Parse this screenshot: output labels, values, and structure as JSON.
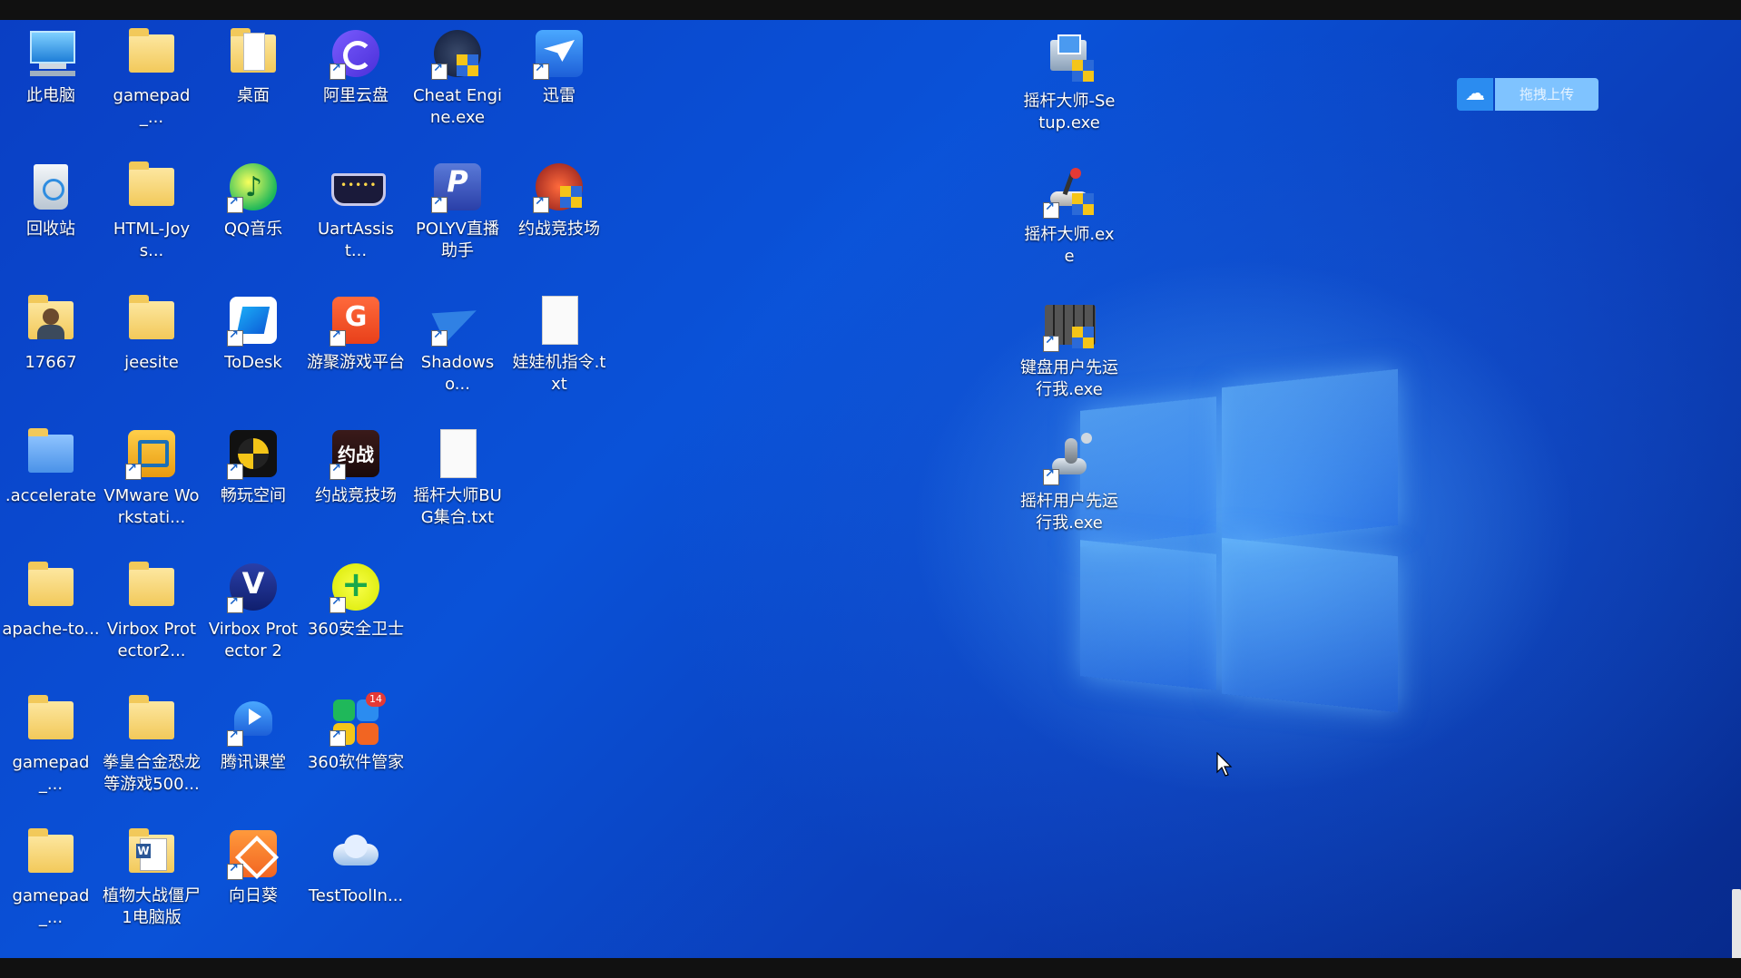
{
  "desktop": {
    "icons": [
      {
        "name": "此电脑",
        "type": "computer"
      },
      {
        "name": "回收站",
        "type": "recycle"
      },
      {
        "name": "17667",
        "type": "user-folder"
      },
      {
        "name": ".accelerate",
        "type": "folder-blue"
      },
      {
        "name": "apache-to...",
        "type": "folder"
      },
      {
        "name": "gamepad_...",
        "type": "folder"
      },
      {
        "name": "gamepad_...",
        "type": "folder"
      },
      {
        "name": "gamepad_...",
        "type": "folder"
      },
      {
        "name": "HTML-Joys...",
        "type": "folder"
      },
      {
        "name": "jeesite",
        "type": "folder"
      },
      {
        "name": "VMware Workstati...",
        "type": "vmware"
      },
      {
        "name": "Virbox Protector2...",
        "type": "folder"
      },
      {
        "name": "拳皇合金恐龙等游戏500...",
        "type": "folder"
      },
      {
        "name": "植物大战僵尸1电脑版",
        "type": "word-doc"
      },
      {
        "name": "桌面",
        "type": "folder-doc"
      },
      {
        "name": "QQ音乐",
        "type": "qqmusic"
      },
      {
        "name": "ToDesk",
        "type": "todesk"
      },
      {
        "name": "畅玩空间",
        "type": "changwan"
      },
      {
        "name": "Virbox Protector 2",
        "type": "virbox"
      },
      {
        "name": "腾讯课堂",
        "type": "tencent-class"
      },
      {
        "name": "向日葵",
        "type": "sunflower"
      },
      {
        "name": "阿里云盘",
        "type": "aliyun"
      },
      {
        "name": "UartAssist...",
        "type": "uart"
      },
      {
        "name": "游聚游戏平台",
        "type": "youju"
      },
      {
        "name": "约战竞技场",
        "type": "yuezhan"
      },
      {
        "name": "360安全卫士",
        "type": "360safe"
      },
      {
        "name": "360软件管家",
        "type": "360soft",
        "badge": "14"
      },
      {
        "name": "TestToolIn...",
        "type": "cloud"
      },
      {
        "name": "Cheat Engine.exe",
        "type": "cheat-engine"
      },
      {
        "name": "POLYV直播助手",
        "type": "polyv"
      },
      {
        "name": "Shadowso...",
        "type": "shadowsocks"
      },
      {
        "name": "摇杆大师BUG集合.txt",
        "type": "txt"
      },
      {
        "name": "迅雷",
        "type": "xunlei"
      },
      {
        "name": "约战竞技场",
        "type": "yuezhan2"
      },
      {
        "name": "娃娃机指令.txt",
        "type": "txt"
      },
      {
        "name": "摇杆大师-Setup.exe",
        "type": "setup"
      },
      {
        "name": "摇杆大师.exe",
        "type": "joystick"
      },
      {
        "name": "键盘用户先运行我.exe",
        "type": "keyboard"
      },
      {
        "name": "摇杆用户先运行我.exe",
        "type": "joystick2"
      }
    ]
  },
  "baidu_upload": {
    "label": "拖拽上传"
  }
}
